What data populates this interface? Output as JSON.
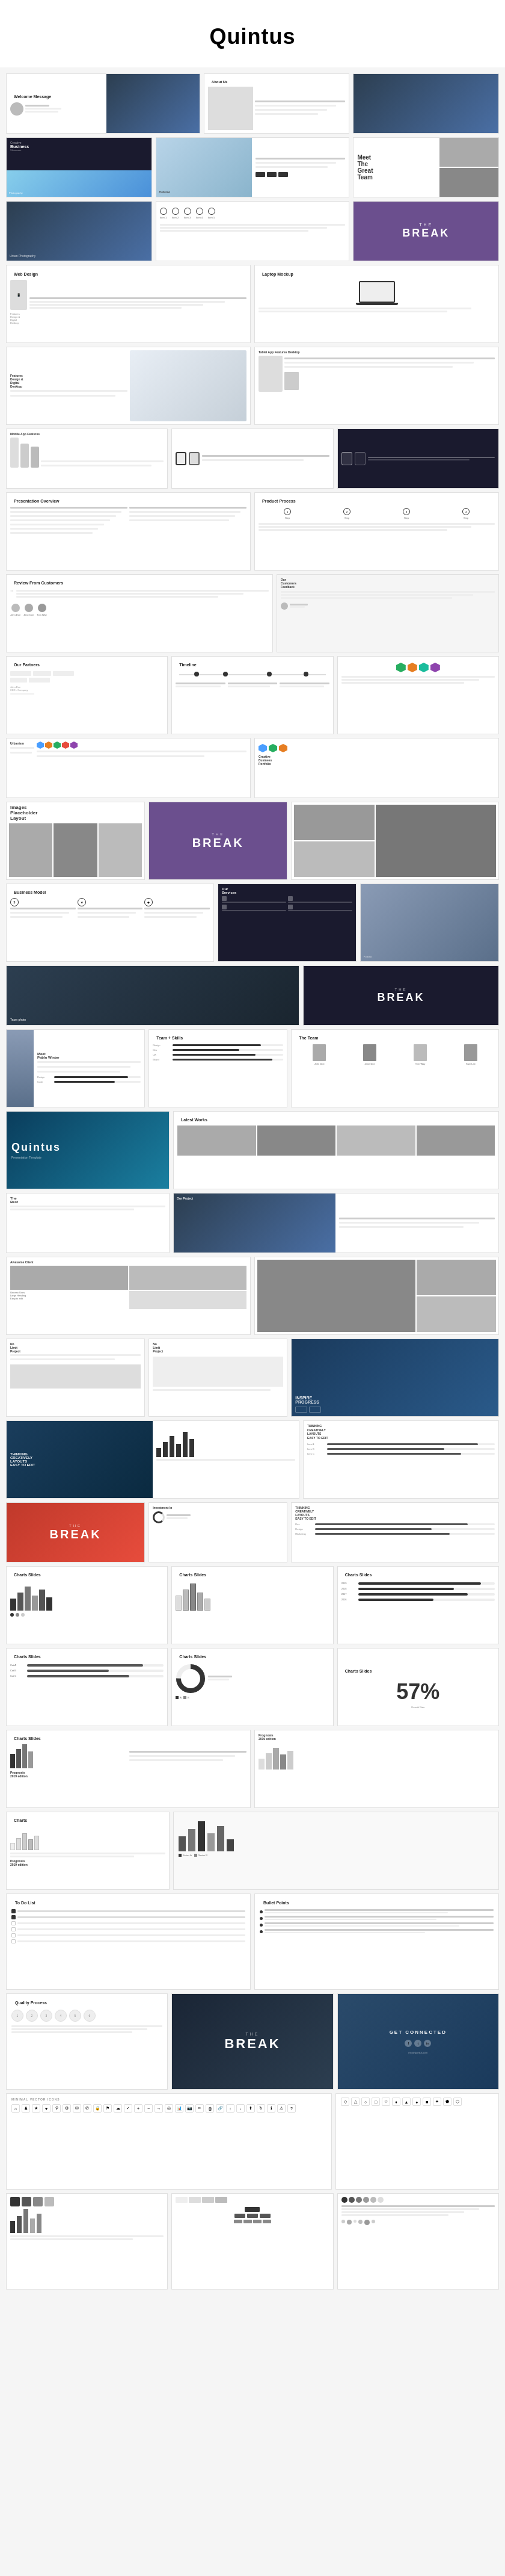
{
  "page": {
    "title": "Quintus"
  },
  "slides": [
    {
      "id": "welcome",
      "label": "Welcome Message",
      "type": "welcome"
    },
    {
      "id": "about",
      "label": "About Us",
      "type": "about"
    },
    {
      "id": "nature1",
      "label": "",
      "type": "full-image-nature"
    },
    {
      "id": "creative",
      "label": "Creative Business",
      "type": "creative"
    },
    {
      "id": "pablo",
      "label": "Pablo Dittes",
      "type": "person"
    },
    {
      "id": "team1",
      "label": "Meet The Great Team",
      "type": "meet-team"
    },
    {
      "id": "dark1",
      "label": "The Break",
      "type": "the-break-dark"
    },
    {
      "id": "web-design",
      "label": "Web Design",
      "type": "web-design"
    },
    {
      "id": "laptop-mockup",
      "label": "Laptop Mockup",
      "type": "laptop-mockup"
    },
    {
      "id": "features",
      "label": "Features",
      "type": "features"
    },
    {
      "id": "tablet-features",
      "label": "Tablet App Features",
      "type": "tablet-features"
    },
    {
      "id": "mobile-mockup",
      "label": "Mobile App Features",
      "type": "mobile-mockup"
    },
    {
      "id": "watches",
      "label": "Watches",
      "type": "watches"
    },
    {
      "id": "pres-overview",
      "label": "Presentation Overview",
      "type": "presentation-overview"
    },
    {
      "id": "product-process",
      "label": "Product Process",
      "type": "product-process"
    },
    {
      "id": "review",
      "label": "Review From Customers",
      "type": "review"
    },
    {
      "id": "partners",
      "label": "Our Partners",
      "type": "partners"
    },
    {
      "id": "timeline",
      "label": "Timeline",
      "type": "timeline"
    },
    {
      "id": "timeline2",
      "label": "",
      "type": "timeline2"
    },
    {
      "id": "images-placeholder",
      "label": "Images Placeholder Layout",
      "type": "images-layout"
    },
    {
      "id": "the-break-purple",
      "label": "The Break",
      "type": "the-break-purple"
    },
    {
      "id": "business-model",
      "label": "Business Model",
      "type": "business-model"
    },
    {
      "id": "services",
      "label": "Our Services",
      "type": "services"
    },
    {
      "id": "image-right",
      "label": "",
      "type": "image-right"
    },
    {
      "id": "the-break-dark2",
      "label": "The Break",
      "type": "the-break-dark2"
    },
    {
      "id": "pablo-winter",
      "label": "Meet Pablo Winter",
      "type": "pablo-winter"
    },
    {
      "id": "team-skills",
      "label": "Team + Skills",
      "type": "team-skills"
    },
    {
      "id": "the-team",
      "label": "The Team",
      "type": "the-team"
    },
    {
      "id": "quintus-branded",
      "label": "Quintus",
      "type": "quintus-branded"
    },
    {
      "id": "latest-works",
      "label": "Latest Works",
      "type": "latest-works"
    },
    {
      "id": "best",
      "label": "The Best",
      "type": "best"
    },
    {
      "id": "our-project",
      "label": "Our Project",
      "type": "our-project"
    },
    {
      "id": "awesome-client",
      "label": "Awesome Client",
      "type": "awesome-client"
    },
    {
      "id": "project-gallery",
      "label": "",
      "type": "project-gallery"
    },
    {
      "id": "progress1",
      "label": "INSPIRE PROGRESS",
      "type": "inspire-progress"
    },
    {
      "id": "progress2",
      "label": "",
      "type": "progress2"
    },
    {
      "id": "the-break-red",
      "label": "The Break",
      "type": "the-break-red"
    },
    {
      "id": "investment",
      "label": "Investment In",
      "type": "investment"
    },
    {
      "id": "thinking",
      "label": "Thinking Creatively",
      "type": "thinking"
    },
    {
      "id": "charts1",
      "label": "Charts Slides",
      "type": "charts1"
    },
    {
      "id": "charts2",
      "label": "Charts Slides",
      "type": "charts2"
    },
    {
      "id": "charts3",
      "label": "Charts Slides",
      "type": "charts3"
    },
    {
      "id": "charts4",
      "label": "Charts Slides",
      "type": "charts4"
    },
    {
      "id": "charts5",
      "label": "Charts Slides",
      "type": "charts5"
    },
    {
      "id": "charts6",
      "label": "Charts Slides",
      "type": "charts6"
    },
    {
      "id": "charts7",
      "label": "Charts Slides",
      "type": "charts7"
    },
    {
      "id": "charts8",
      "label": "Charts Slides",
      "type": "charts8"
    },
    {
      "id": "charts9",
      "label": "Charts",
      "type": "charts9"
    },
    {
      "id": "to-do-list",
      "label": "To Do List",
      "type": "to-do-list"
    },
    {
      "id": "bullet-points",
      "label": "Bullet Points",
      "type": "bullet-points"
    },
    {
      "id": "quality-process",
      "label": "Quality Process",
      "type": "quality-process"
    },
    {
      "id": "the-break-dark3",
      "label": "The Break",
      "type": "the-break-dark3"
    },
    {
      "id": "get-connected",
      "label": "Get Connected",
      "type": "get-connected"
    },
    {
      "id": "minimal-vector",
      "label": "Minimal Vector Icons",
      "type": "minimal-vector"
    },
    {
      "id": "vector-icons2",
      "label": "",
      "type": "vector-icons2"
    },
    {
      "id": "bottom1",
      "label": "",
      "type": "bottom1"
    },
    {
      "id": "bottom2",
      "label": "",
      "type": "bottom2"
    },
    {
      "id": "bottom3",
      "label": "",
      "type": "bottom3"
    }
  ]
}
